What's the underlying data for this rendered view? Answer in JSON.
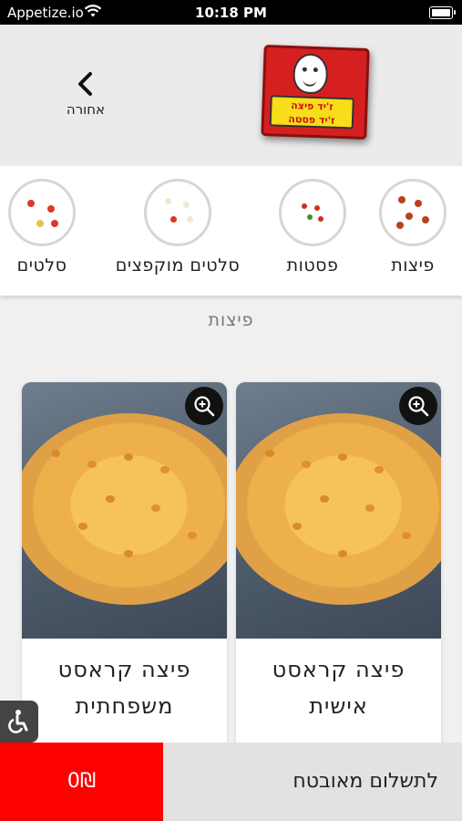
{
  "status_bar": {
    "carrier": "Appetize.io",
    "time": "10:18 PM"
  },
  "header": {
    "back_label": "אחורה",
    "logo_text_line1": "ז'יד פיצה",
    "logo_text_line2": "ז'יד פסטה"
  },
  "categories": [
    {
      "label": "פיצות",
      "icon": "pizza-thumbnail"
    },
    {
      "label": "פסטות",
      "icon": "pasta-thumbnail"
    },
    {
      "label": "סלטים מוקפצים",
      "icon": "stir-fry-salad-thumbnail"
    },
    {
      "label": "סלטים",
      "icon": "salad-thumbnail"
    }
  ],
  "section_title": "פיצות",
  "products": [
    {
      "name": "פיצה קראסט אישית",
      "zoom_icon": "zoom-in-icon"
    },
    {
      "name": "פיצה קראסט משפחתית",
      "zoom_icon": "zoom-in-icon"
    }
  ],
  "footer": {
    "cart_total": "0₪",
    "pay_label": "לתשלום מאובטח"
  },
  "colors": {
    "accent": "#fd0000",
    "header_bg": "#ebebeb",
    "pay_bg": "#e2e2e2"
  }
}
